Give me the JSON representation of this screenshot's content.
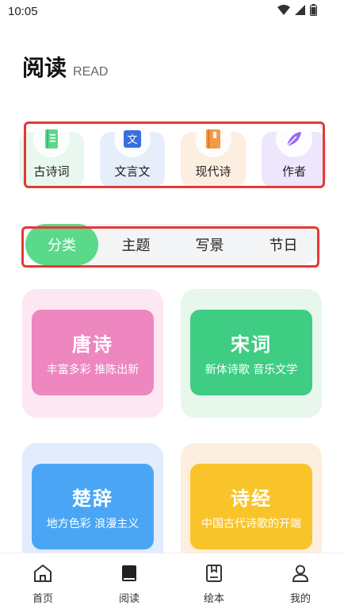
{
  "status_bar": {
    "time": "10:05",
    "icons": [
      "wifi-icon",
      "signal-icon",
      "battery-icon"
    ]
  },
  "header": {
    "title": "阅读",
    "subtitle": "READ"
  },
  "categories": [
    {
      "label": "古诗词",
      "icon": "notebook-icon",
      "color": "#5bd98a",
      "bg": "#e9f8ee"
    },
    {
      "label": "文言文",
      "icon": "wen-icon",
      "color": "#3b6fe0",
      "bg": "#e6eefc"
    },
    {
      "label": "现代诗",
      "icon": "book-icon",
      "color": "#f39a4a",
      "bg": "#fdeee2"
    },
    {
      "label": "作者",
      "icon": "feather-icon",
      "color": "#9b6bf0",
      "bg": "#ede6fd"
    }
  ],
  "tabs": [
    {
      "label": "分类",
      "active": true
    },
    {
      "label": "主题",
      "active": false
    },
    {
      "label": "写景",
      "active": false
    },
    {
      "label": "节日",
      "active": false
    }
  ],
  "cards": [
    {
      "title": "唐诗",
      "subtitle": "丰富多彩 推陈出新",
      "outer": "#fde7f3",
      "inner": "#ee86c0"
    },
    {
      "title": "宋词",
      "subtitle": "新体诗歌 音乐文学",
      "outer": "#e7f7ec",
      "inner": "#3fcd84"
    },
    {
      "title": "楚辞",
      "subtitle": "地方色彩 浪漫主义",
      "outer": "#e3ecfd",
      "inner": "#4aa6f5"
    },
    {
      "title": "诗经",
      "subtitle": "中国古代诗歌的开端",
      "outer": "#fdeedd",
      "inner": "#f9c42a"
    }
  ],
  "bottom_nav": [
    {
      "label": "首页",
      "icon": "home-icon",
      "active": false
    },
    {
      "label": "阅读",
      "icon": "read-icon",
      "active": true
    },
    {
      "label": "绘本",
      "icon": "picture-book-icon",
      "active": false
    },
    {
      "label": "我的",
      "icon": "user-icon",
      "active": false
    }
  ]
}
